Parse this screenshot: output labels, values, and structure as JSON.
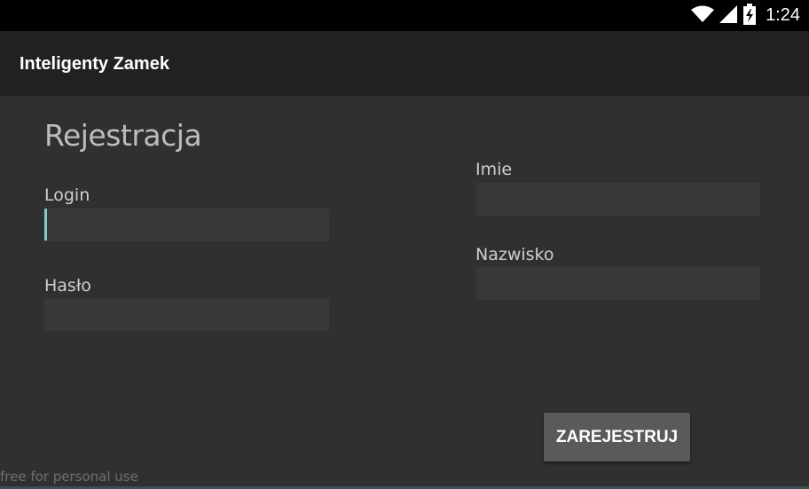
{
  "status_bar": {
    "time": "1:24",
    "icons": [
      "wifi-icon",
      "signal-icon",
      "battery-charging-icon"
    ]
  },
  "app_bar": {
    "title": "Inteligenty Zamek"
  },
  "form": {
    "heading": "Rejestracja",
    "login_label": "Login",
    "login_value": "",
    "password_label": "Hasło",
    "password_value": "",
    "first_name_label": "Imie",
    "first_name_value": "",
    "last_name_label": "Nazwisko",
    "last_name_value": "",
    "submit_label": "ZAREJESTRUJ"
  },
  "watermark": "free for personal use",
  "colors": {
    "background": "#303030",
    "app_bar": "#212121",
    "status_bar": "#000000",
    "field": "#383838",
    "cursor_accent": "#80cbc4",
    "button": "#5a5a5a"
  }
}
